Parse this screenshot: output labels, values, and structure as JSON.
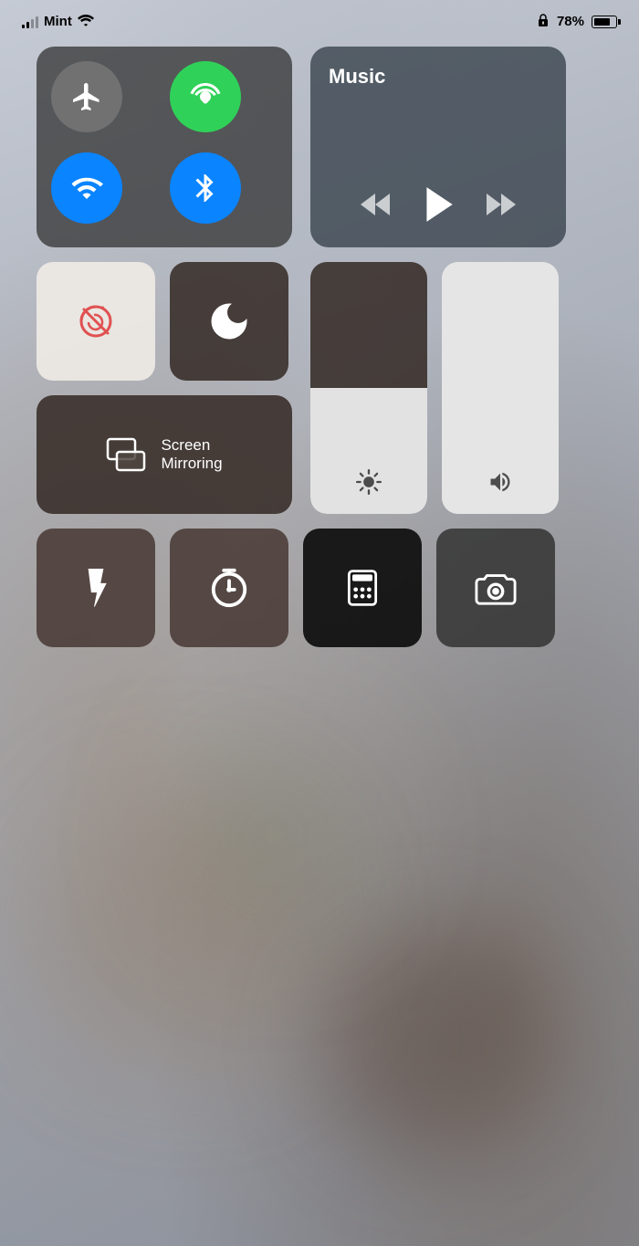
{
  "statusBar": {
    "carrier": "Mint",
    "batteryPercent": "78%",
    "signalBars": 2
  },
  "connectivity": {
    "airplaneMode": "Airplane Mode",
    "cellular": "Cellular",
    "wifi": "Wi-Fi",
    "bluetooth": "Bluetooth"
  },
  "music": {
    "title": "Music",
    "rewindLabel": "Rewind",
    "playLabel": "Play",
    "fastForwardLabel": "Fast Forward"
  },
  "controls": {
    "rotationLock": "Rotation Lock",
    "doNotDisturb": "Do Not Disturb",
    "screenMirroring": "Screen\nMirroring",
    "screenMirroringLine1": "Screen",
    "screenMirroringLine2": "Mirroring"
  },
  "sliders": {
    "brightness": "Brightness",
    "volume": "Volume",
    "brightnessLevel": 50,
    "volumeLevel": 100
  },
  "bottomButtons": {
    "flashlight": "Flashlight",
    "timer": "Timer",
    "calculator": "Calculator",
    "camera": "Camera"
  }
}
